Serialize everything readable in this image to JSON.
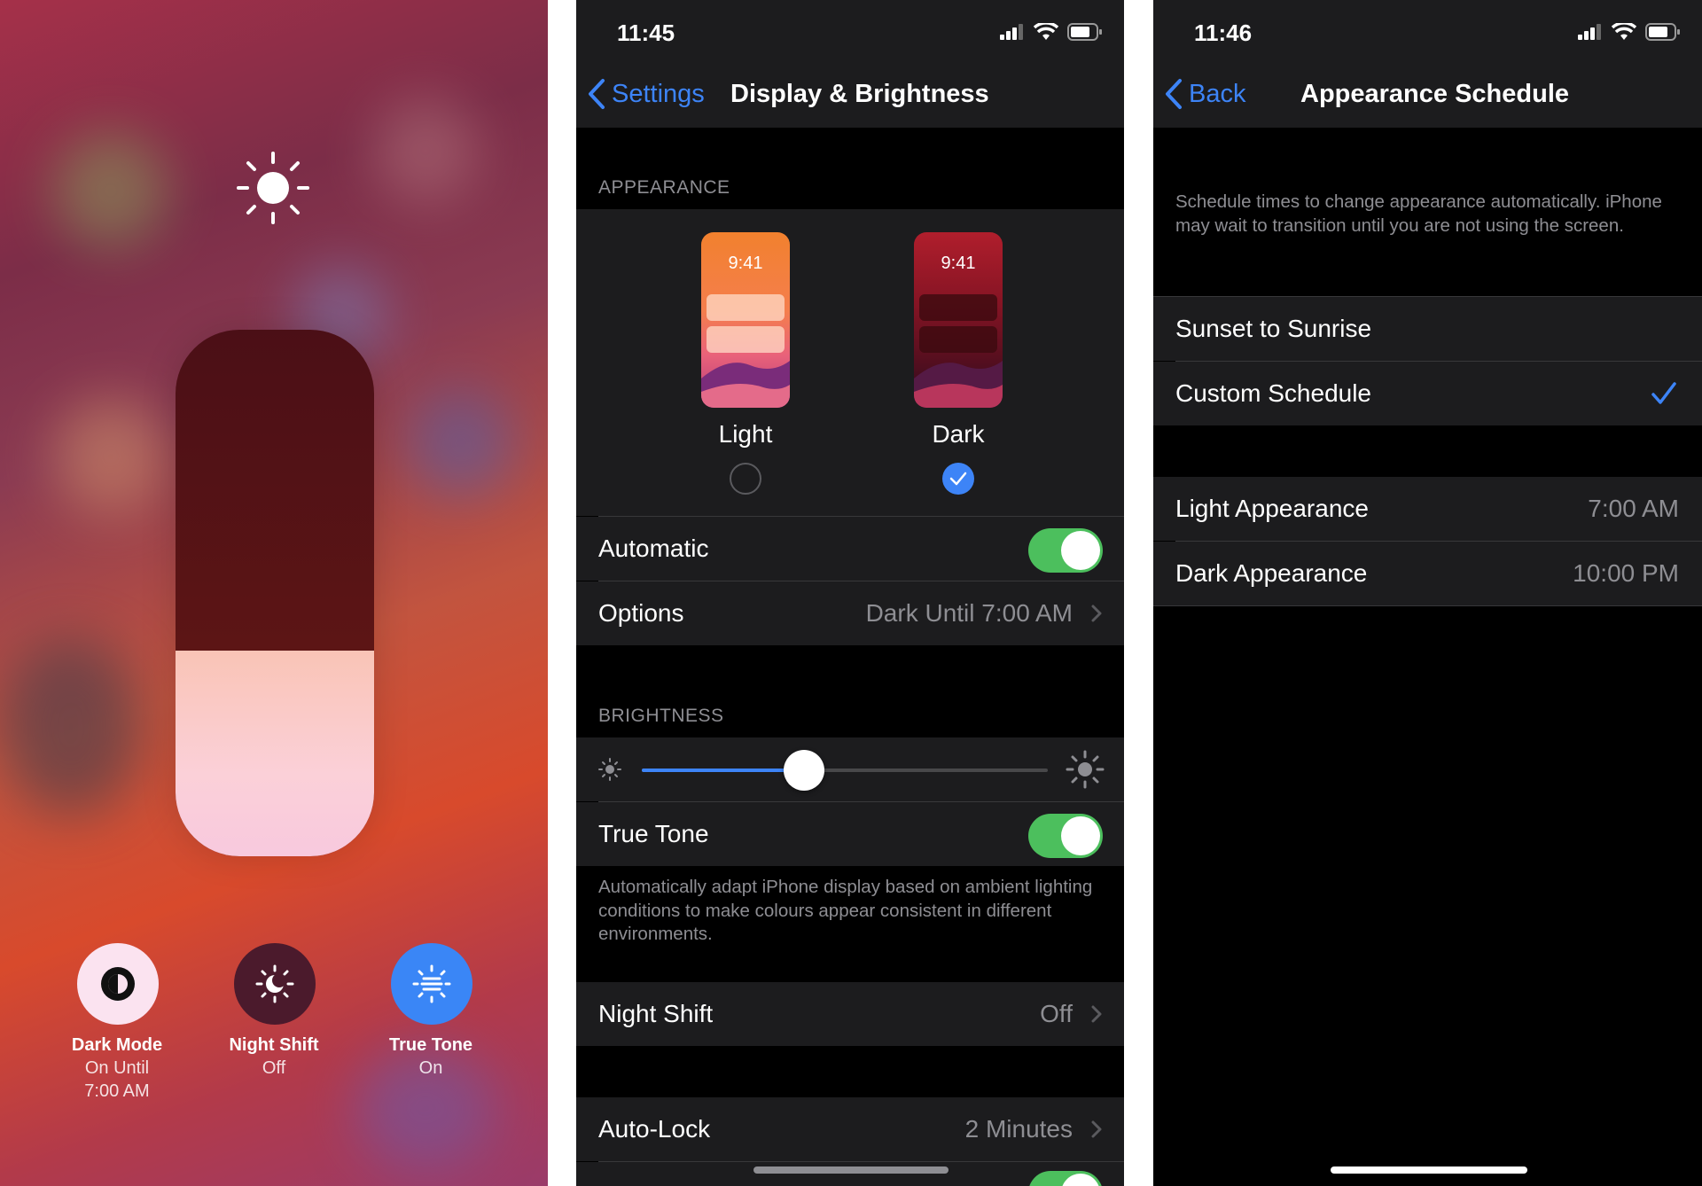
{
  "control_center": {
    "brightness_level": 0.39,
    "tiles": [
      {
        "title": "Dark Mode",
        "subtitle": "On Until\n7:00 AM",
        "icon": "dark-mode-icon"
      },
      {
        "title": "Night Shift",
        "subtitle": "Off",
        "icon": "night-shift-icon"
      },
      {
        "title": "True Tone",
        "subtitle": "On",
        "icon": "true-tone-icon"
      }
    ]
  },
  "display_brightness": {
    "status_time": "11:45",
    "back_label": "Settings",
    "title": "Display & Brightness",
    "appearance_header": "APPEARANCE",
    "mock_time": "9:41",
    "light_label": "Light",
    "dark_label": "Dark",
    "selected_appearance": "Dark",
    "automatic_label": "Automatic",
    "automatic_on": true,
    "options_label": "Options",
    "options_value": "Dark Until 7:00 AM",
    "brightness_header": "BRIGHTNESS",
    "brightness_level": 0.4,
    "true_tone_label": "True Tone",
    "true_tone_on": true,
    "true_tone_footer": "Automatically adapt iPhone display based on ambient lighting conditions to make colours appear consistent in different environments.",
    "night_shift_label": "Night Shift",
    "night_shift_value": "Off",
    "auto_lock_label": "Auto-Lock",
    "auto_lock_value": "2 Minutes"
  },
  "appearance_schedule": {
    "status_time": "11:46",
    "back_label": "Back",
    "title": "Appearance Schedule",
    "description": "Schedule times to change appearance automatically. iPhone may wait to transition until you are not using the screen.",
    "options": [
      {
        "label": "Sunset to Sunrise",
        "selected": false
      },
      {
        "label": "Custom Schedule",
        "selected": true
      }
    ],
    "light_appearance_label": "Light Appearance",
    "light_appearance_value": "7:00 AM",
    "dark_appearance_label": "Dark Appearance",
    "dark_appearance_value": "10:00 PM"
  },
  "colors": {
    "accent_blue": "#3d84f7",
    "toggle_green": "#4cbf5d",
    "cell_bg": "#1c1c1e",
    "secondary_text": "#8e8e93"
  }
}
